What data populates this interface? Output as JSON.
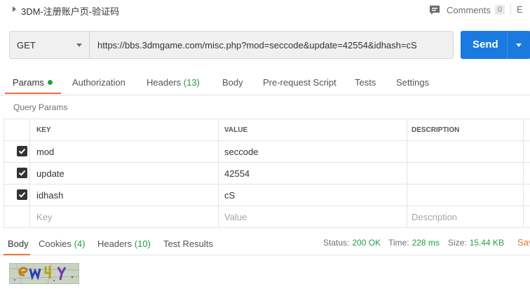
{
  "request": {
    "title": "3DM-注册账户页-验证码",
    "comments_label": "Comments",
    "comments_count": "0",
    "topbar_extra": "E"
  },
  "urlbar": {
    "method": "GET",
    "url": "https://bbs.3dmgame.com/misc.php?mod=seccode&update=42554&idhash=cS",
    "send_label": "Send"
  },
  "request_tabs": [
    {
      "label": "Params",
      "active": true
    },
    {
      "label": "Authorization"
    },
    {
      "label": "Headers",
      "count": "(13)"
    },
    {
      "label": "Body"
    },
    {
      "label": "Pre-request Script"
    },
    {
      "label": "Tests"
    },
    {
      "label": "Settings"
    }
  ],
  "query_params": {
    "section_label": "Query Params",
    "columns": [
      "KEY",
      "VALUE",
      "DESCRIPTION"
    ],
    "rows": [
      {
        "checked": true,
        "key": "mod",
        "value": "seccode",
        "description": ""
      },
      {
        "checked": true,
        "key": "update",
        "value": "42554",
        "description": ""
      },
      {
        "checked": true,
        "key": "idhash",
        "value": "cS",
        "description": ""
      }
    ],
    "placeholder": {
      "key": "Key",
      "value": "Value",
      "description": "Description"
    }
  },
  "response_tabs": [
    {
      "label": "Body",
      "active": true
    },
    {
      "label": "Cookies",
      "count": "(4)"
    },
    {
      "label": "Headers",
      "count": "(10)"
    },
    {
      "label": "Test Results"
    }
  ],
  "response_status": {
    "status_label": "Status:",
    "status_value": "200 OK",
    "time_label": "Time:",
    "time_value": "228 ms",
    "size_label": "Size:",
    "size_value": "15.44 KB",
    "save_label": "Sav"
  },
  "colors": {
    "accent_orange": "#f26b3a",
    "send_blue": "#1a7ae0",
    "success_green": "#20a044"
  }
}
